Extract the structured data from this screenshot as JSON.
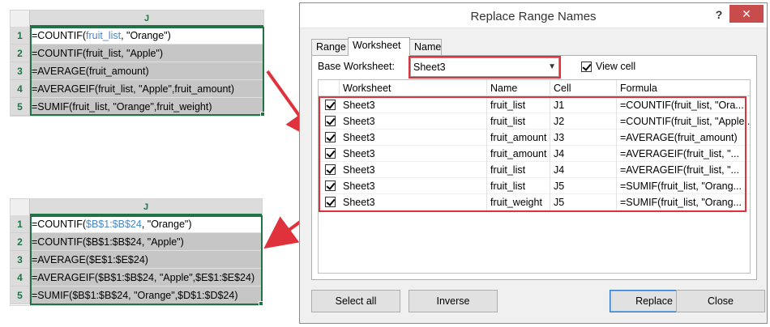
{
  "top_sheet": {
    "column": "J",
    "rows": [
      {
        "num": "1",
        "pre": "=COUNTIF(",
        "ref": "fruit_list",
        "post": ", \"Orange\")"
      },
      {
        "num": "2",
        "pre": "=COUNTIF(fruit_list, \"Apple\")",
        "ref": "",
        "post": ""
      },
      {
        "num": "3",
        "pre": "=AVERAGE(fruit_amount)",
        "ref": "",
        "post": ""
      },
      {
        "num": "4",
        "pre": "=AVERAGEIF(fruit_list, \"Apple\",fruit_amount)",
        "ref": "",
        "post": ""
      },
      {
        "num": "5",
        "pre": "=SUMIF(fruit_list, \"Orange\",fruit_weight)",
        "ref": "",
        "post": ""
      }
    ]
  },
  "bottom_sheet": {
    "column": "J",
    "rows": [
      {
        "num": "1",
        "pre": "=COUNTIF(",
        "ref": "$B$1:$B$24",
        "post": ", \"Orange\")"
      },
      {
        "num": "2",
        "pre": "=COUNTIF($B$1:$B$24, \"Apple\")",
        "ref": "",
        "post": ""
      },
      {
        "num": "3",
        "pre": "=AVERAGE($E$1:$E$24)",
        "ref": "",
        "post": ""
      },
      {
        "num": "4",
        "pre": "=AVERAGEIF($B$1:$B$24, \"Apple\",$E$1:$E$24)",
        "ref": "",
        "post": ""
      },
      {
        "num": "5",
        "pre": "=SUMIF($B$1:$B$24, \"Orange\",$D$1:$D$24)",
        "ref": "",
        "post": ""
      }
    ]
  },
  "dialog": {
    "title": "Replace Range Names",
    "help": "?",
    "close": "✕",
    "tabs": [
      "Range",
      "Worksheet",
      "Name"
    ],
    "active_tab": "Worksheet",
    "base_worksheet_label": "Base Worksheet:",
    "base_worksheet_value": "Sheet3",
    "view_cell_label": "View cell",
    "view_cell_checked": true,
    "columns": [
      "Worksheet",
      "Name",
      "Cell",
      "Formula"
    ],
    "rows": [
      {
        "checked": true,
        "worksheet": "Sheet3",
        "name": "fruit_list",
        "cell": "J1",
        "formula": "=COUNTIF(fruit_list, \"Ora..."
      },
      {
        "checked": true,
        "worksheet": "Sheet3",
        "name": "fruit_list",
        "cell": "J2",
        "formula": "=COUNTIF(fruit_list, \"Apple..."
      },
      {
        "checked": true,
        "worksheet": "Sheet3",
        "name": "fruit_amount",
        "cell": "J3",
        "formula": "=AVERAGE(fruit_amount)"
      },
      {
        "checked": true,
        "worksheet": "Sheet3",
        "name": "fruit_amount",
        "cell": "J4",
        "formula": "=AVERAGEIF(fruit_list, \"..."
      },
      {
        "checked": true,
        "worksheet": "Sheet3",
        "name": "fruit_list",
        "cell": "J4",
        "formula": "=AVERAGEIF(fruit_list, \"..."
      },
      {
        "checked": true,
        "worksheet": "Sheet3",
        "name": "fruit_list",
        "cell": "J5",
        "formula": "=SUMIF(fruit_list, \"Orang..."
      },
      {
        "checked": true,
        "worksheet": "Sheet3",
        "name": "fruit_weight",
        "cell": "J5",
        "formula": "=SUMIF(fruit_list, \"Orang..."
      }
    ],
    "buttons": {
      "select_all": "Select all",
      "inverse": "Inverse",
      "replace": "Replace",
      "close": "Close"
    },
    "colors": {
      "highlight": "#e0323c",
      "excel_green": "#217346"
    }
  }
}
